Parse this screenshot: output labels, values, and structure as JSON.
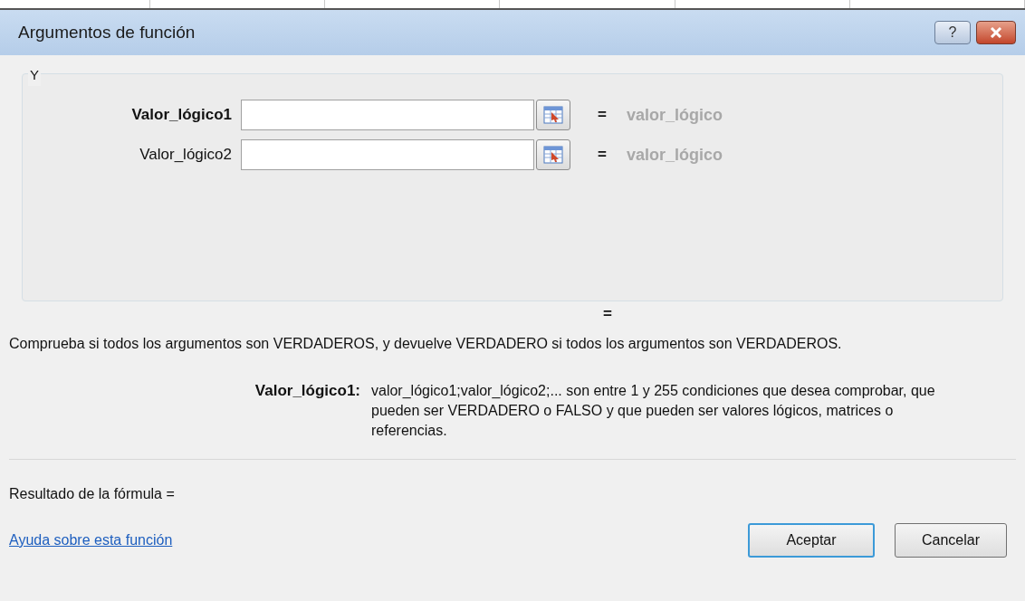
{
  "window": {
    "title": "Argumentos de función",
    "help_button": "?"
  },
  "group": {
    "title": "Y",
    "arguments": [
      {
        "label": "Valor_lógico1",
        "active": true,
        "equals": "=",
        "result": "valor_lógico"
      },
      {
        "label": "Valor_lógico2",
        "active": false,
        "equals": "=",
        "result": "valor_lógico"
      }
    ]
  },
  "overall_equals": "=",
  "description": "Comprueba si todos los argumentos son VERDADEROS, y devuelve VERDADERO si todos los argumentos son VERDADEROS.",
  "argument_help": {
    "label": "Valor_lógico1:",
    "text": "valor_lógico1;valor_lógico2;... son entre 1 y 255 condiciones que desea comprobar, que pueden ser VERDADERO o FALSO y que pueden ser valores lógicos, matrices o referencias."
  },
  "formula_result": "Resultado de la fórmula =",
  "help_link": "Ayuda sobre esta función",
  "buttons": [
    {
      "label": "Aceptar",
      "default": true
    },
    {
      "label": "Cancelar",
      "default": false
    }
  ]
}
